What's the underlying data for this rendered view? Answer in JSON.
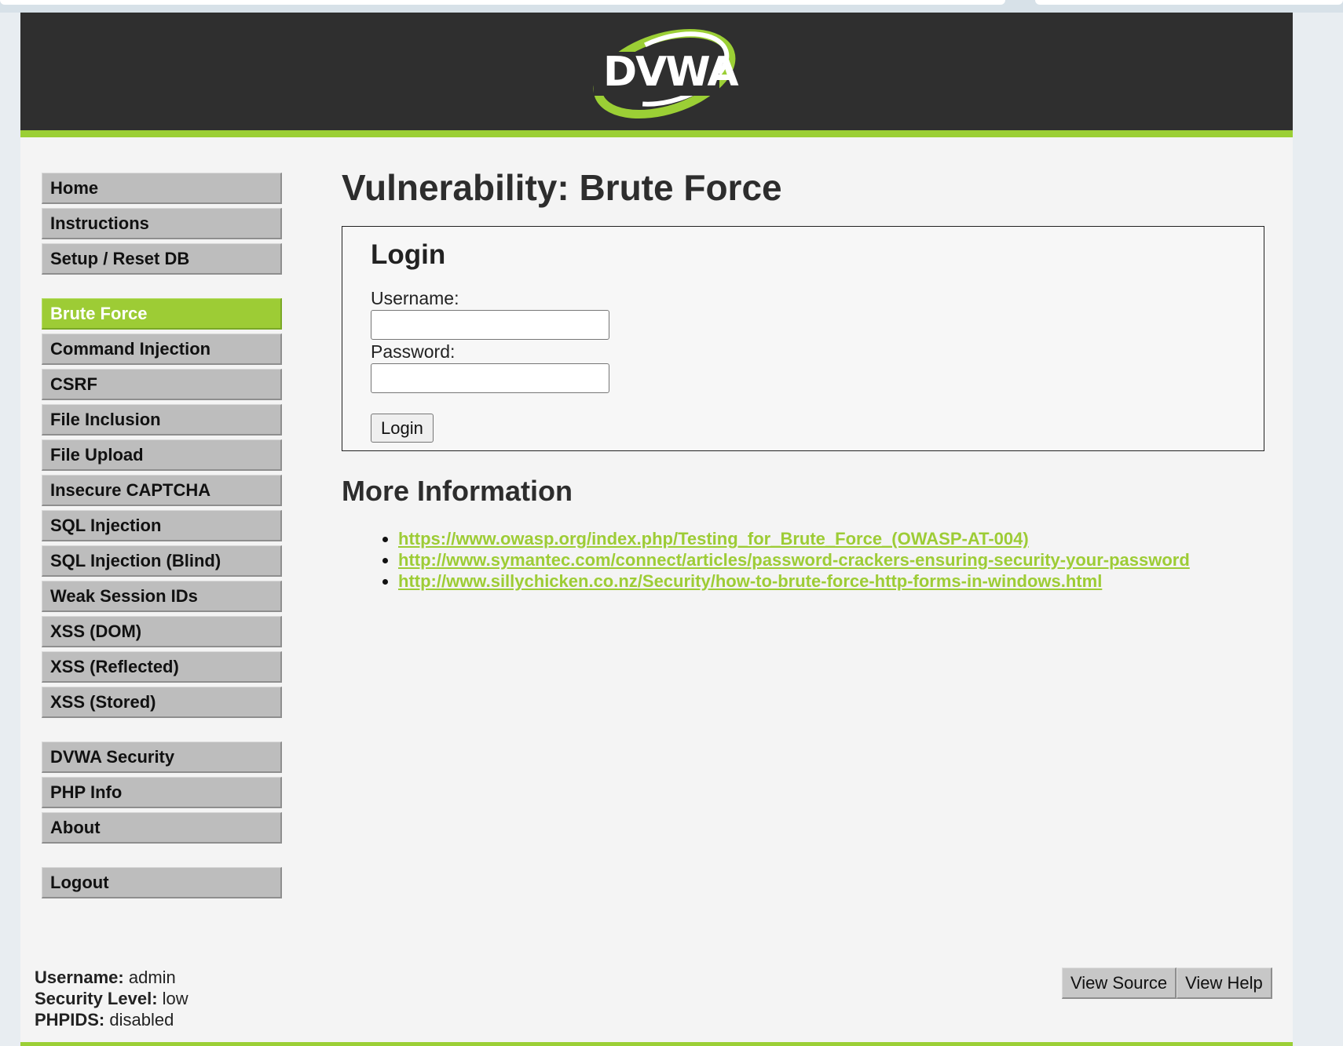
{
  "header": {
    "logo_text": "DVWA"
  },
  "sidebar": {
    "groups": [
      [
        {
          "label": "Home"
        },
        {
          "label": "Instructions"
        },
        {
          "label": "Setup / Reset DB"
        }
      ],
      [
        {
          "label": "Brute Force",
          "active": true
        },
        {
          "label": "Command Injection"
        },
        {
          "label": "CSRF"
        },
        {
          "label": "File Inclusion"
        },
        {
          "label": "File Upload"
        },
        {
          "label": "Insecure CAPTCHA"
        },
        {
          "label": "SQL Injection"
        },
        {
          "label": "SQL Injection (Blind)"
        },
        {
          "label": "Weak Session IDs"
        },
        {
          "label": "XSS (DOM)"
        },
        {
          "label": "XSS (Reflected)"
        },
        {
          "label": "XSS (Stored)"
        }
      ],
      [
        {
          "label": "DVWA Security"
        },
        {
          "label": "PHP Info"
        },
        {
          "label": "About"
        }
      ],
      [
        {
          "label": "Logout"
        }
      ]
    ]
  },
  "main": {
    "title": "Vulnerability: Brute Force",
    "login": {
      "heading": "Login",
      "username_label": "Username:",
      "username_value": "",
      "password_label": "Password:",
      "password_value": "",
      "button_label": "Login"
    },
    "more_info": {
      "heading": "More Information",
      "links": [
        "https://www.owasp.org/index.php/Testing_for_Brute_Force_(OWASP-AT-004)",
        "http://www.symantec.com/connect/articles/password-crackers-ensuring-security-your-password",
        "http://www.sillychicken.co.nz/Security/how-to-brute-force-http-forms-in-windows.html"
      ]
    }
  },
  "user_info": {
    "username_label": "Username:",
    "username_value": "admin",
    "security_label": "Security Level:",
    "security_value": "low",
    "phpids_label": "PHPIDS:",
    "phpids_value": "disabled"
  },
  "footer": {
    "view_source_label": "View Source",
    "view_help_label": "View Help"
  },
  "colors": {
    "accent_green": "#9dcc35",
    "header_dark": "#2f2f2f",
    "menu_grey": "#bdbdbd"
  }
}
